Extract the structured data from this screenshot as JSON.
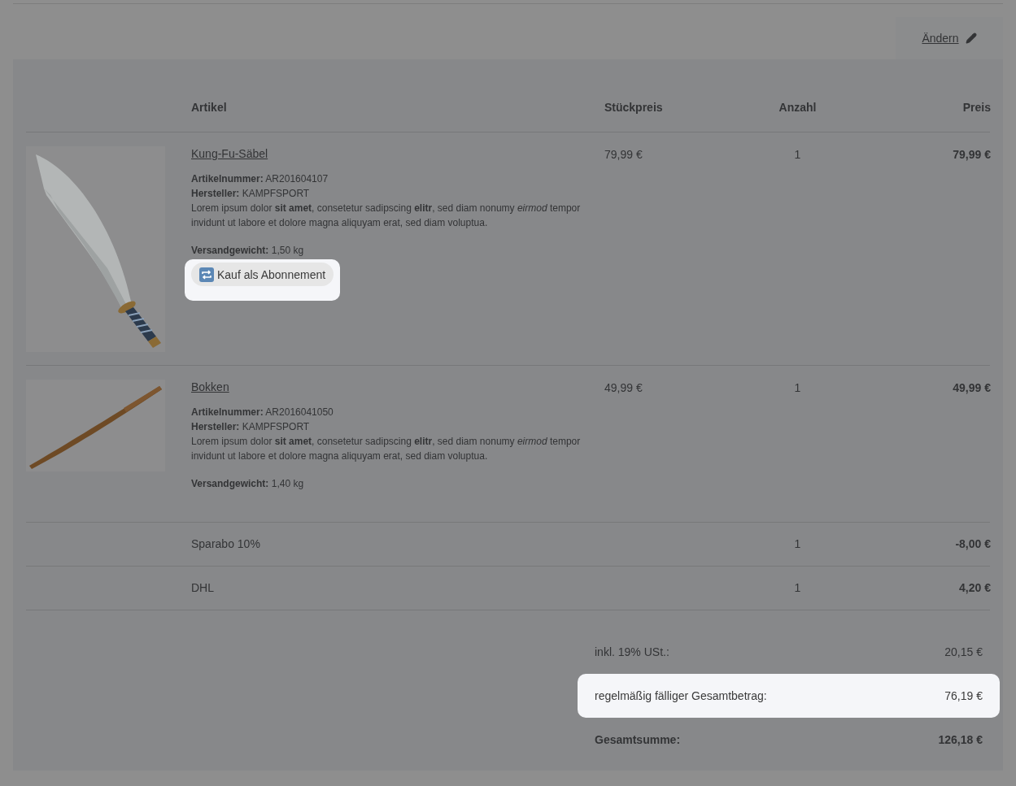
{
  "edit_link": "Ändern",
  "table": {
    "columns": [
      "Artikel",
      "Stückpreis",
      "Anzahl",
      "Preis"
    ],
    "rows": [
      {
        "kind": "product",
        "name": "Kung-Fu-Säbel",
        "meta": [
          "**Artikelnummer:** AR201604107",
          "**Hersteller:** KAMPFSPORT"
        ],
        "description": "Lorem ipsum dolor **sit amet**, consetetur sadipscing **elitr**, sed diam nonumy *eirmod* tempor invidunt ut labore et dolore magna aliquyam erat, sed diam voluptua.",
        "weight": "**Versandgewicht:** 1,50 kg",
        "subscription": {
          "label": "Kauf als Abonnement",
          "highlighted": true
        },
        "unit_price": "79,99 €",
        "quantity": "1",
        "price": "79,99 €"
      },
      {
        "kind": "product",
        "name": "Bokken",
        "meta": [
          "**Artikelnummer:** AR2016041050",
          "**Hersteller:** KAMPFSPORT"
        ],
        "description": "Lorem ipsum dolor **sit amet**, consetetur sadipscing **elitr**, sed diam nonumy *eirmod* tempor invidunt ut labore et dolore magna aliquyam erat, sed diam voluptua.",
        "weight": "**Versandgewicht:** 1,40 kg",
        "unit_price": "49,99 €",
        "quantity": "1",
        "price": "49,99 €"
      },
      {
        "kind": "line",
        "name": "Sparabo 10%",
        "quantity": "1",
        "price": "-8,00 €"
      },
      {
        "kind": "line",
        "name": "DHL",
        "quantity": "1",
        "price": "4,20 €"
      }
    ]
  },
  "totals": [
    {
      "label": "inkl. 19% USt.:",
      "value": "20,15 €",
      "highlighted": false,
      "bold": false
    },
    {
      "label": "regelmäßig fälliger Gesamtbetrag:",
      "value": "76,19 €",
      "highlighted": true,
      "bold": false
    },
    {
      "label": "Gesamtsumme:",
      "value": "126,18 €",
      "highlighted": false,
      "bold": true
    }
  ]
}
